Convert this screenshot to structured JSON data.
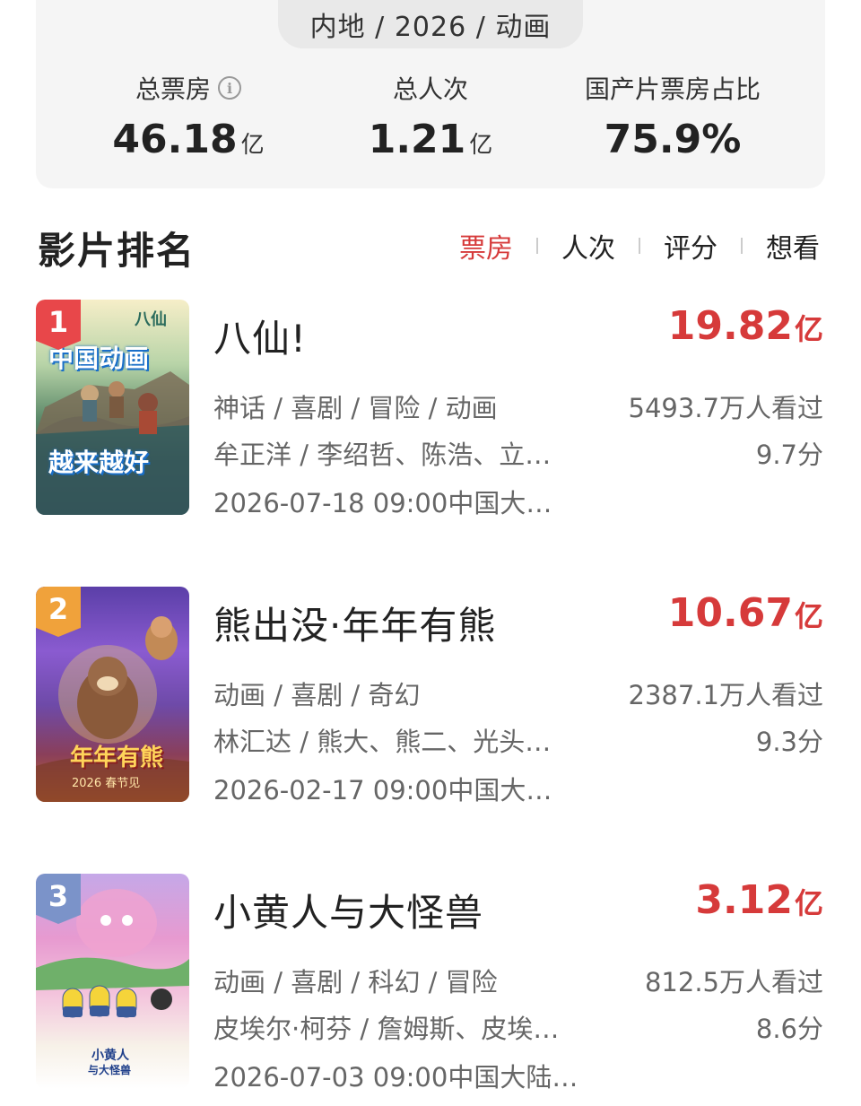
{
  "filter": "内地 / 2026 / 动画",
  "stats": [
    {
      "label": "总票房",
      "value": "46.18",
      "unit": "亿",
      "has_info": true
    },
    {
      "label": "总人次",
      "value": "1.21",
      "unit": "亿",
      "has_info": false
    },
    {
      "label": "国产片票房占比",
      "value": "75.9%",
      "unit": "",
      "has_info": false
    }
  ],
  "section_title": "影片排名",
  "sort_tabs": [
    {
      "label": "票房",
      "active": true
    },
    {
      "label": "人次",
      "active": false
    },
    {
      "label": "评分",
      "active": false
    },
    {
      "label": "想看",
      "active": false
    }
  ],
  "movies": [
    {
      "rank": "1",
      "rank_color": "#e8474a",
      "title": "八仙!",
      "box_office": "19.82",
      "box_office_unit": "亿",
      "genres": "神话 / 喜剧 / 冒险 / 动画",
      "people": "牟正洋 / 李绍哲、陈浩、立…",
      "release": "2026-07-18 09:00中国大…",
      "viewers": "5493.7万人看过",
      "score": "9.7分",
      "poster_lines": [
        "八仙",
        "中国动画",
        "越来越好"
      ]
    },
    {
      "rank": "2",
      "rank_color": "#f0a23b",
      "title": "熊出没·年年有熊",
      "box_office": "10.67",
      "box_office_unit": "亿",
      "genres": "动画 / 喜剧 / 奇幻",
      "people": "林汇达 / 熊大、熊二、光头…",
      "release": "2026-02-17 09:00中国大…",
      "viewers": "2387.1万人看过",
      "score": "9.3分",
      "poster_lines": [
        "年年有熊",
        "2026 春节见"
      ]
    },
    {
      "rank": "3",
      "rank_color": "#7b93c9",
      "title": "小黄人与大怪兽",
      "box_office": "3.12",
      "box_office_unit": "亿",
      "genres": "动画 / 喜剧 / 科幻 / 冒险",
      "people": "皮埃尔·柯芬 / 詹姆斯、皮埃…",
      "release": "2026-07-03 09:00中国大陆…",
      "viewers": "812.5万人看过",
      "score": "8.6分",
      "poster_lines": [
        "小黄人",
        "与大怪兽"
      ]
    }
  ]
}
